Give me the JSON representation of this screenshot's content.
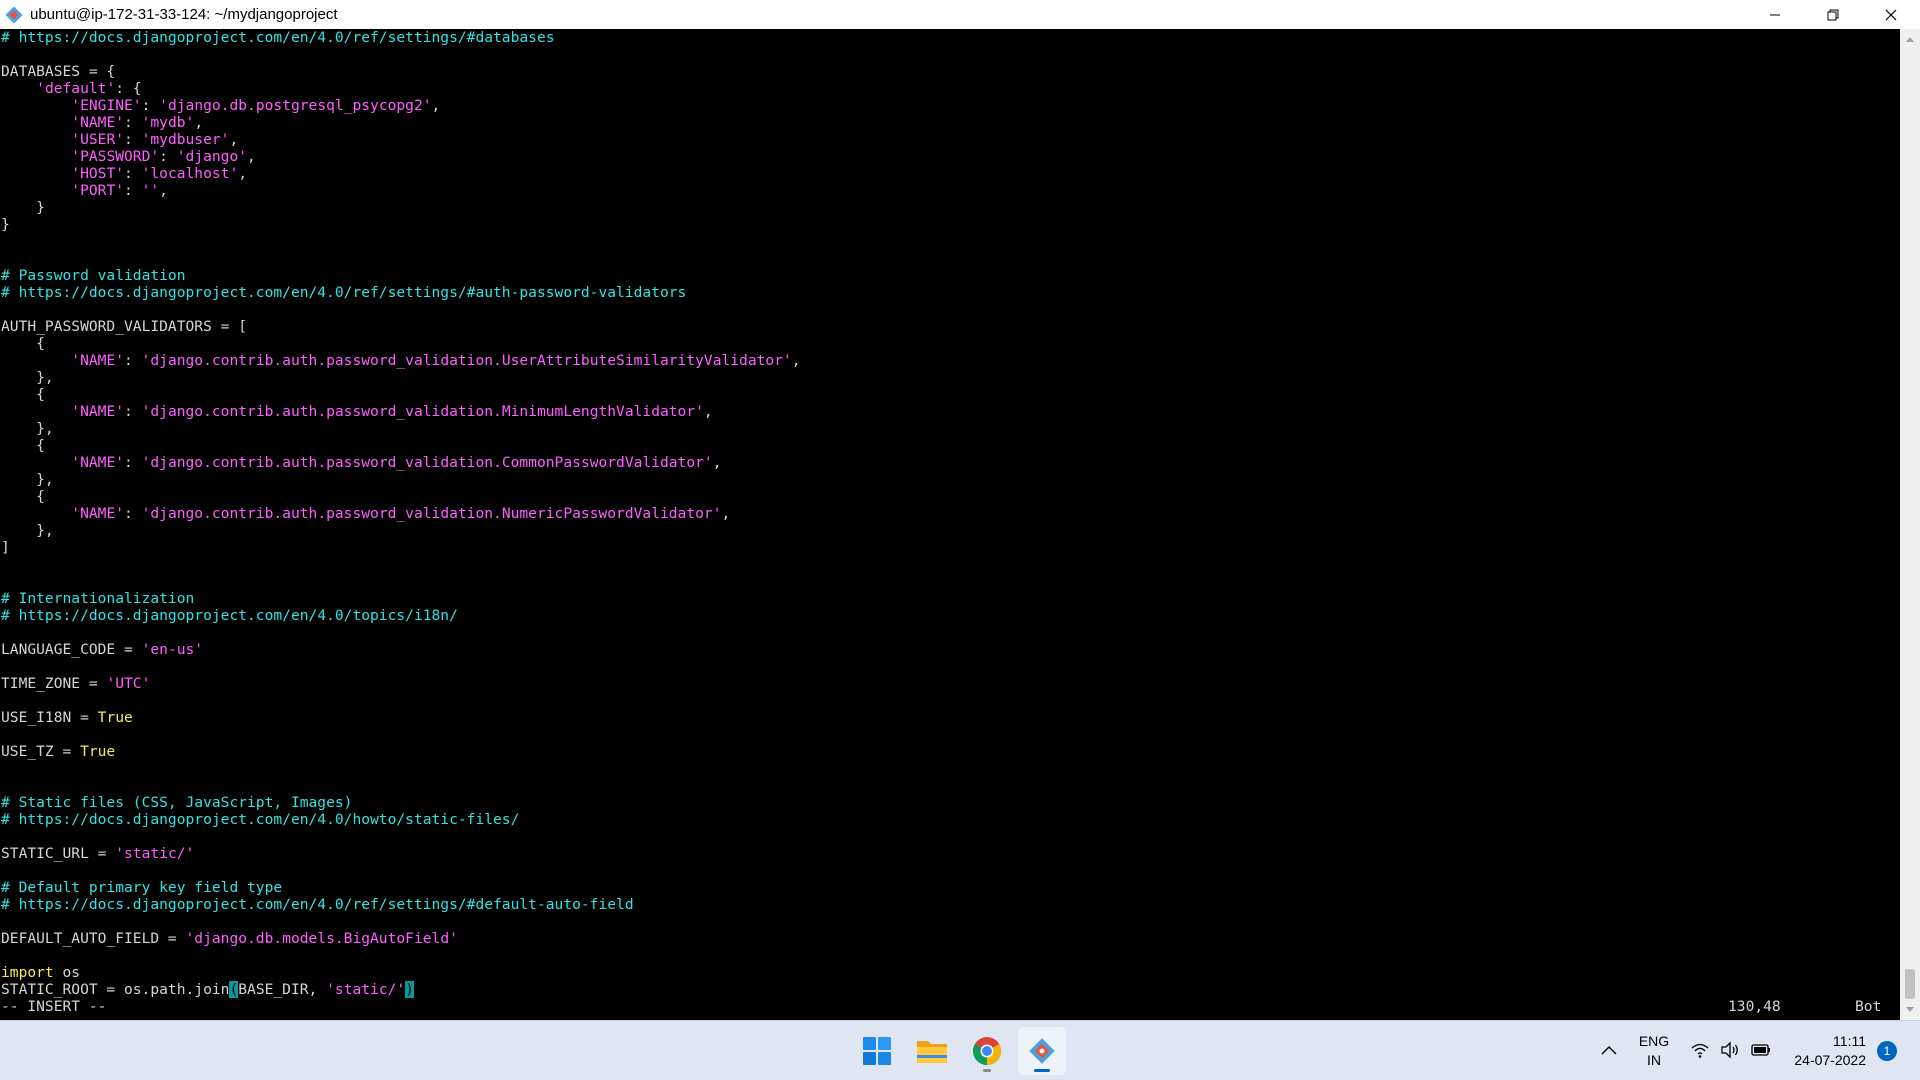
{
  "window": {
    "title": "ubuntu@ip-172-31-33-124: ~/mydjangoproject",
    "minimize_icon": "minimize-icon",
    "maximize_icon": "restore-icon",
    "close_icon": "close-icon"
  },
  "editor": {
    "lines": [
      [
        [
          "cm",
          "# https://docs.djangoproject.com/en/4.0/ref/settings/#databases"
        ]
      ],
      [],
      [
        [
          "txt",
          "DATABASES = {"
        ]
      ],
      [
        [
          "txt",
          "    "
        ],
        [
          "str",
          "'default'"
        ],
        [
          "txt",
          ": {"
        ]
      ],
      [
        [
          "txt",
          "        "
        ],
        [
          "str",
          "'ENGINE'"
        ],
        [
          "txt",
          ": "
        ],
        [
          "str",
          "'django.db.postgresql_psycopg2'"
        ],
        [
          "txt",
          ","
        ]
      ],
      [
        [
          "txt",
          "        "
        ],
        [
          "str",
          "'NAME'"
        ],
        [
          "txt",
          ": "
        ],
        [
          "str",
          "'mydb'"
        ],
        [
          "txt",
          ","
        ]
      ],
      [
        [
          "txt",
          "        "
        ],
        [
          "str",
          "'USER'"
        ],
        [
          "txt",
          ": "
        ],
        [
          "str",
          "'mydbuser'"
        ],
        [
          "txt",
          ","
        ]
      ],
      [
        [
          "txt",
          "        "
        ],
        [
          "str",
          "'PASSWORD'"
        ],
        [
          "txt",
          ": "
        ],
        [
          "str",
          "'django'"
        ],
        [
          "txt",
          ","
        ]
      ],
      [
        [
          "txt",
          "        "
        ],
        [
          "str",
          "'HOST'"
        ],
        [
          "txt",
          ": "
        ],
        [
          "str",
          "'localhost'"
        ],
        [
          "txt",
          ","
        ]
      ],
      [
        [
          "txt",
          "        "
        ],
        [
          "str",
          "'PORT'"
        ],
        [
          "txt",
          ": "
        ],
        [
          "str",
          "''"
        ],
        [
          "txt",
          ","
        ]
      ],
      [
        [
          "txt",
          "    }"
        ]
      ],
      [
        [
          "txt",
          "}"
        ]
      ],
      [],
      [],
      [
        [
          "cm",
          "# Password validation"
        ]
      ],
      [
        [
          "cm",
          "# https://docs.djangoproject.com/en/4.0/ref/settings/#auth-password-validators"
        ]
      ],
      [],
      [
        [
          "txt",
          "AUTH_PASSWORD_VALIDATORS = ["
        ]
      ],
      [
        [
          "txt",
          "    {"
        ]
      ],
      [
        [
          "txt",
          "        "
        ],
        [
          "str",
          "'NAME'"
        ],
        [
          "txt",
          ": "
        ],
        [
          "str",
          "'django.contrib.auth.password_validation.UserAttributeSimilarityValidator'"
        ],
        [
          "txt",
          ","
        ]
      ],
      [
        [
          "txt",
          "    },"
        ]
      ],
      [
        [
          "txt",
          "    {"
        ]
      ],
      [
        [
          "txt",
          "        "
        ],
        [
          "str",
          "'NAME'"
        ],
        [
          "txt",
          ": "
        ],
        [
          "str",
          "'django.contrib.auth.password_validation.MinimumLengthValidator'"
        ],
        [
          "txt",
          ","
        ]
      ],
      [
        [
          "txt",
          "    },"
        ]
      ],
      [
        [
          "txt",
          "    {"
        ]
      ],
      [
        [
          "txt",
          "        "
        ],
        [
          "str",
          "'NAME'"
        ],
        [
          "txt",
          ": "
        ],
        [
          "str",
          "'django.contrib.auth.password_validation.CommonPasswordValidator'"
        ],
        [
          "txt",
          ","
        ]
      ],
      [
        [
          "txt",
          "    },"
        ]
      ],
      [
        [
          "txt",
          "    {"
        ]
      ],
      [
        [
          "txt",
          "        "
        ],
        [
          "str",
          "'NAME'"
        ],
        [
          "txt",
          ": "
        ],
        [
          "str",
          "'django.contrib.auth.password_validation.NumericPasswordValidator'"
        ],
        [
          "txt",
          ","
        ]
      ],
      [
        [
          "txt",
          "    },"
        ]
      ],
      [
        [
          "txt",
          "]"
        ]
      ],
      [],
      [],
      [
        [
          "cm",
          "# Internationalization"
        ]
      ],
      [
        [
          "cm",
          "# https://docs.djangoproject.com/en/4.0/topics/i18n/"
        ]
      ],
      [],
      [
        [
          "txt",
          "LANGUAGE_CODE = "
        ],
        [
          "str",
          "'en-us'"
        ]
      ],
      [],
      [
        [
          "txt",
          "TIME_ZONE = "
        ],
        [
          "str",
          "'UTC'"
        ]
      ],
      [],
      [
        [
          "txt",
          "USE_I18N = "
        ],
        [
          "kw",
          "True"
        ]
      ],
      [],
      [
        [
          "txt",
          "USE_TZ = "
        ],
        [
          "kw",
          "True"
        ]
      ],
      [],
      [],
      [
        [
          "cm",
          "# Static files (CSS, JavaScript, Images)"
        ]
      ],
      [
        [
          "cm",
          "# https://docs.djangoproject.com/en/4.0/howto/static-files/"
        ]
      ],
      [],
      [
        [
          "txt",
          "STATIC_URL = "
        ],
        [
          "str",
          "'static/'"
        ]
      ],
      [],
      [
        [
          "cm",
          "# Default primary key field type"
        ]
      ],
      [
        [
          "cm",
          "# https://docs.djangoproject.com/en/4.0/ref/settings/#default-auto-field"
        ]
      ],
      [],
      [
        [
          "txt",
          "DEFAULT_AUTO_FIELD = "
        ],
        [
          "str",
          "'django.db.models.BigAutoField'"
        ]
      ],
      [],
      [
        [
          "kw",
          "import"
        ],
        [
          "txt",
          " os"
        ]
      ],
      [
        [
          "txt",
          "STATIC_ROOT = os.path.join"
        ],
        [
          "cur",
          "("
        ],
        [
          "txt",
          "BASE_DIR, "
        ],
        [
          "str",
          "'static/'"
        ],
        [
          "cur",
          ")"
        ]
      ]
    ]
  },
  "statusline": {
    "mode": "-- INSERT --",
    "position": "130,48",
    "scroll": "Bot"
  },
  "taskbar": {
    "apps": [
      {
        "name": "start-button",
        "icon": "windows-logo-icon"
      },
      {
        "name": "file-explorer-button",
        "icon": "folder-icon"
      },
      {
        "name": "chrome-button",
        "icon": "chrome-icon"
      },
      {
        "name": "terminal-button",
        "icon": "git-icon"
      }
    ],
    "tray_lang_top": "ENG",
    "tray_lang_bottom": "IN",
    "time": "11:11",
    "date": "24-07-2022",
    "notification_count": "1"
  }
}
